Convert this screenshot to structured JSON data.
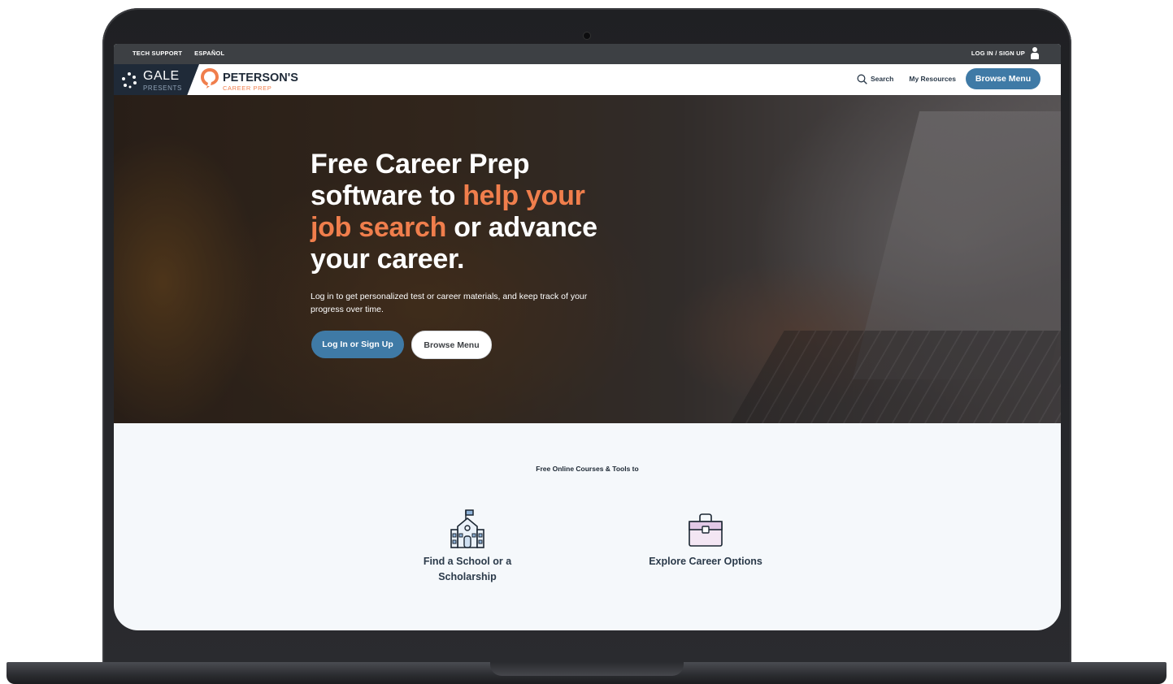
{
  "utility_bar": {
    "tech_support": "TECH SUPPORT",
    "espanol": "ESPAÑOL",
    "login_signup": "LOG IN / SIGN UP"
  },
  "header": {
    "gale_name": "GALE",
    "gale_presents": "PRESENTS",
    "petersons_name": "PETERSON'S",
    "petersons_sub": "CAREER PREP",
    "search_label": "Search",
    "resources_label": "My Resources",
    "browse_menu_label": "Browse Menu"
  },
  "hero": {
    "title_part1": "Free Career Prep software to ",
    "title_accent1": "help your job search",
    "title_part2": " or advance your career.",
    "subtitle": "Log in to get personalized test or career materials, and keep track of your progress over time.",
    "login_button": "Log In or Sign Up",
    "browse_button": "Browse Menu"
  },
  "lower": {
    "heading": "Free Online Courses & Tools to",
    "cards": [
      {
        "label": "Find a School or a Scholarship",
        "icon": "school-icon"
      },
      {
        "label": "Explore Career Options",
        "icon": "briefcase-icon"
      }
    ]
  },
  "colors": {
    "accent_orange": "#f07e4c",
    "primary_blue": "#3f7aa6",
    "navy": "#1f2a38"
  }
}
